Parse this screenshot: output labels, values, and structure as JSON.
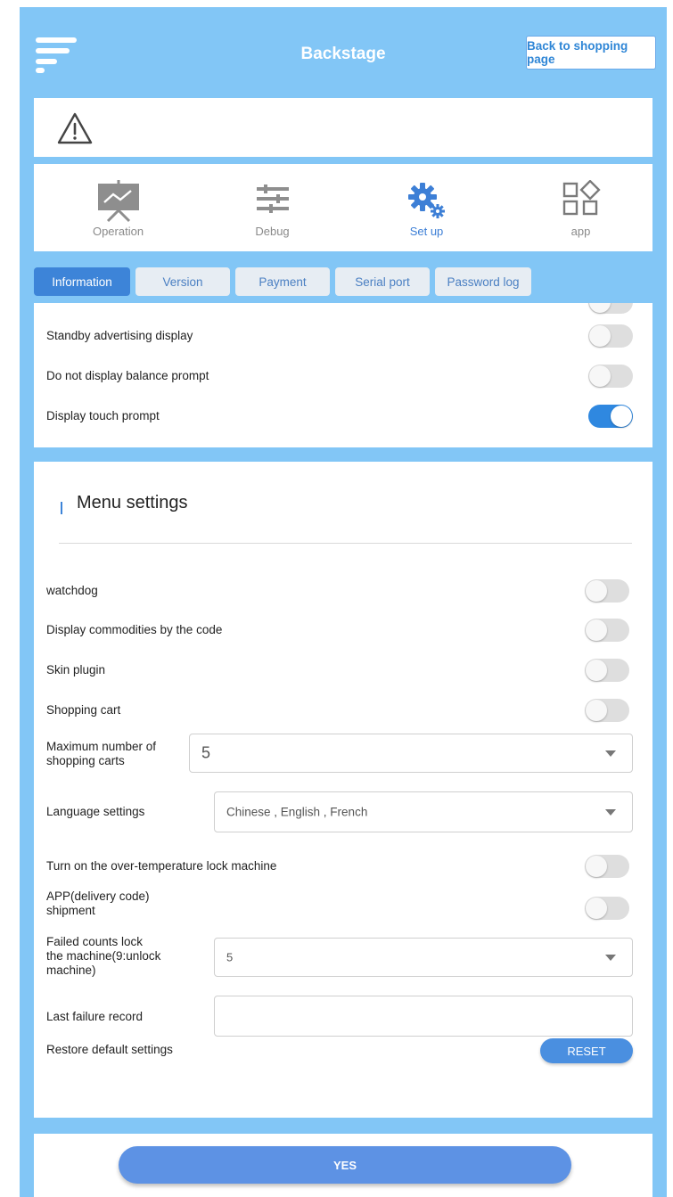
{
  "header": {
    "title": "Backstage",
    "back_label": "Back to shopping page"
  },
  "nav": [
    {
      "label": "Operation",
      "icon": "presentation-chart-icon",
      "active": false
    },
    {
      "label": "Debug",
      "icon": "sliders-icon",
      "active": false
    },
    {
      "label": "Set up",
      "icon": "gears-icon",
      "active": true
    },
    {
      "label": "app",
      "icon": "app-grid-icon",
      "active": false
    }
  ],
  "subtabs": [
    {
      "label": "Information",
      "active": true
    },
    {
      "label": "Version",
      "active": false
    },
    {
      "label": "Payment",
      "active": false
    },
    {
      "label": "Serial port",
      "active": false
    },
    {
      "label": "Password log",
      "active": false
    }
  ],
  "info_settings": [
    {
      "label": "Standby advertising display",
      "on": false
    },
    {
      "label": "Do not display balance prompt",
      "on": false
    },
    {
      "label": "Display touch prompt",
      "on": true
    }
  ],
  "menu": {
    "title": "Menu settings",
    "toggles": [
      {
        "label": "watchdog",
        "on": false
      },
      {
        "label": "Display commodities by the code",
        "on": false
      },
      {
        "label": "Skin plugin",
        "on": false
      },
      {
        "label": "Shopping cart",
        "on": false
      }
    ],
    "max_carts_label_1": "Maximum number of",
    "max_carts_label_2": "shopping carts",
    "max_carts_value": "5",
    "language_label": "Language settings",
    "language_value": "Chinese , English , French",
    "overtemp_label": "Turn on the over-temperature lock machine",
    "overtemp_on": false,
    "app_shipment_label_1": "APP(delivery code)",
    "app_shipment_label_2": "shipment",
    "app_shipment_on": false,
    "failed_label_1": "Failed counts lock",
    "failed_label_2": "the machine(9:unlock",
    "failed_label_3": "machine)",
    "failed_value": "5",
    "last_failure_label": "Last failure record",
    "last_failure_value": "",
    "restore_label": "Restore default settings",
    "reset_label": "RESET"
  },
  "footer": {
    "yes_label": "YES"
  },
  "colors": {
    "background": "#82c6f6",
    "accent": "#3d84d8",
    "toggle_on": "#2f88e0",
    "button": "#5d92e4"
  }
}
